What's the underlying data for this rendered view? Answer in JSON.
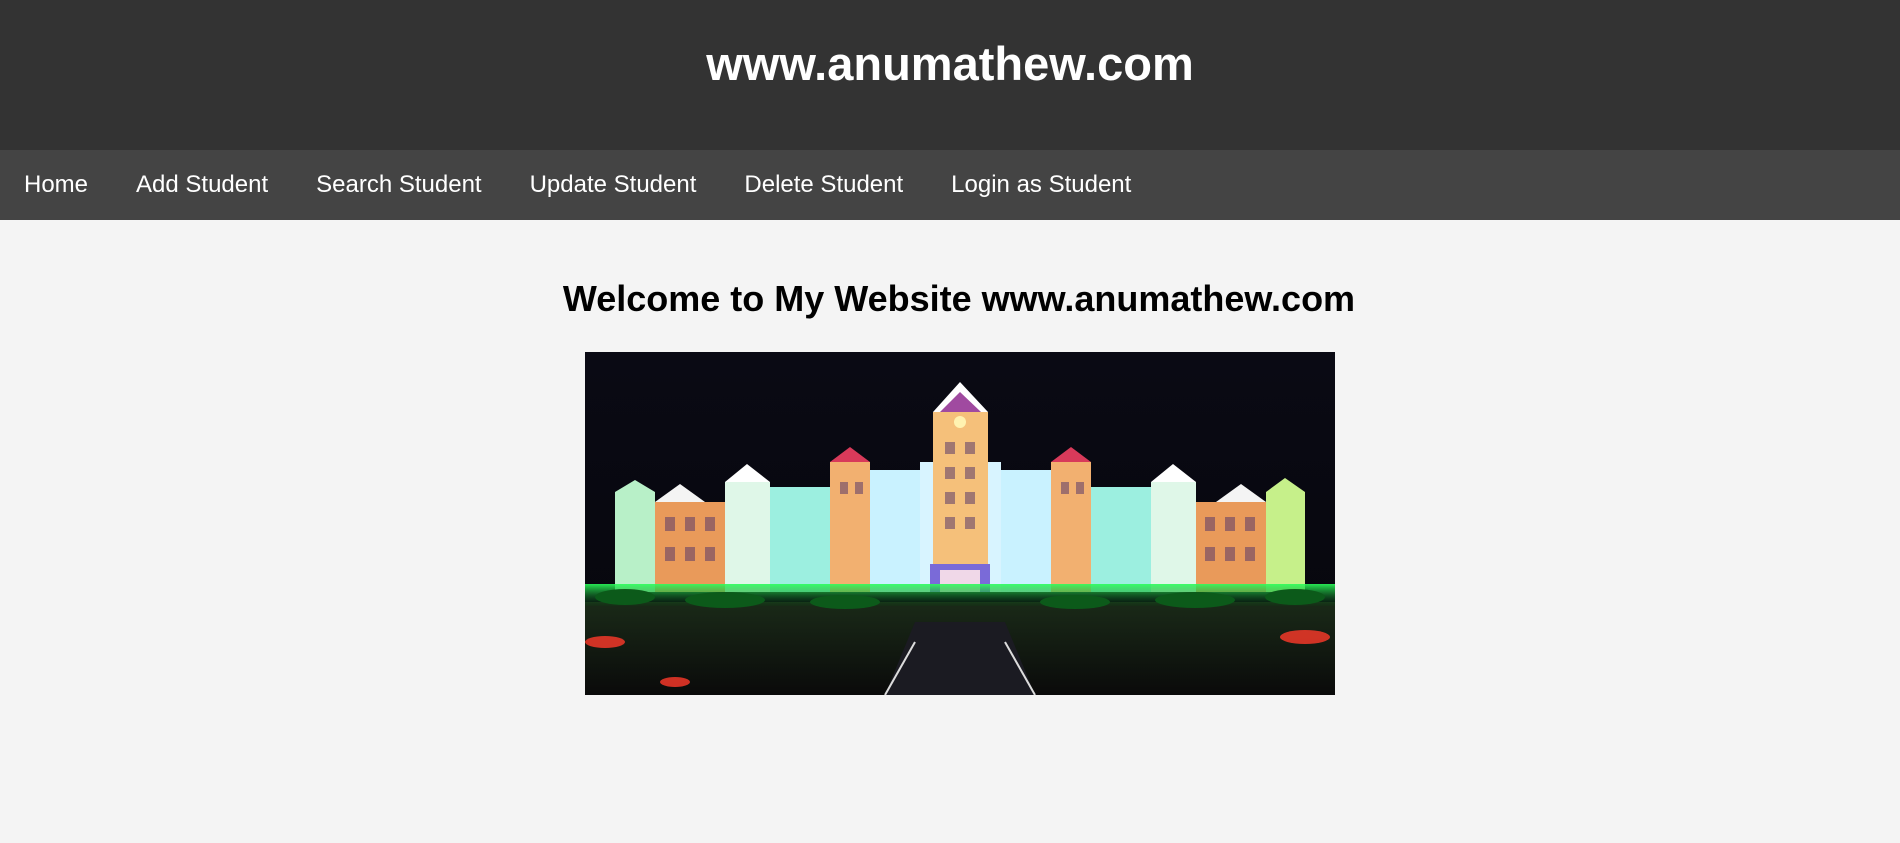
{
  "header": {
    "title": "www.anumathew.com"
  },
  "nav": {
    "items": [
      {
        "label": "Home"
      },
      {
        "label": "Add Student"
      },
      {
        "label": "Search Student"
      },
      {
        "label": "Update Student"
      },
      {
        "label": "Delete Student"
      },
      {
        "label": "Login as Student"
      }
    ]
  },
  "main": {
    "welcome": "Welcome to My Website www.anumathew.com"
  },
  "colors": {
    "header_bg": "#333333",
    "nav_bg": "#444444",
    "page_bg": "#f4f4f4",
    "text_light": "#ffffff"
  }
}
